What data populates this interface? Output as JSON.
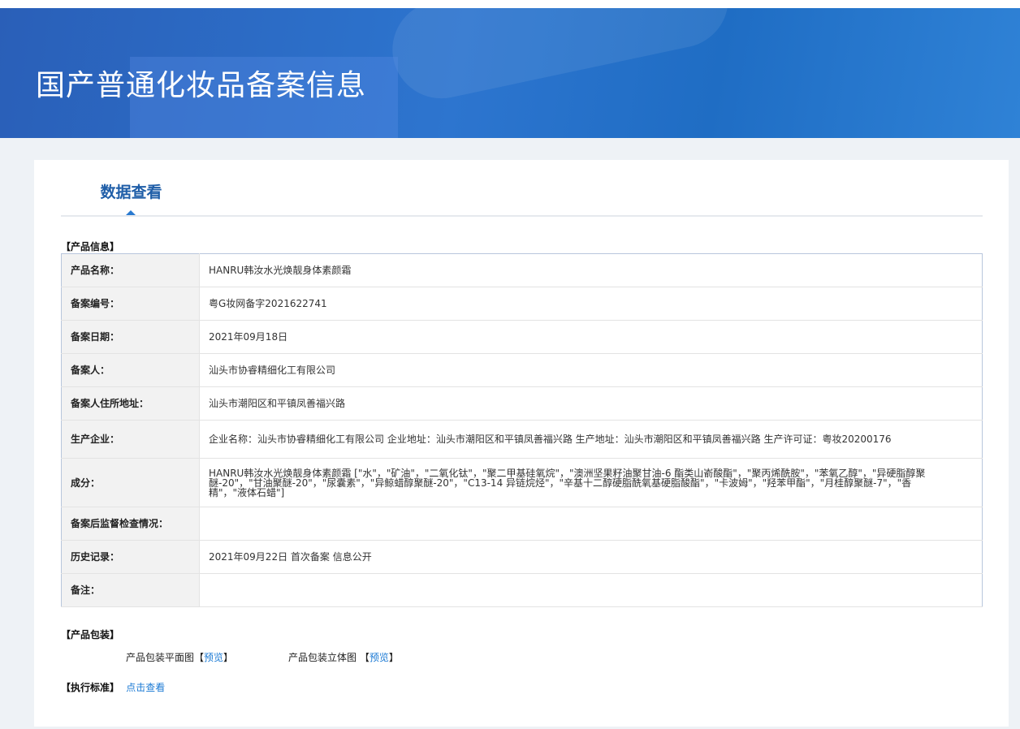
{
  "header": {
    "title": "国产普通化妆品备案信息"
  },
  "tab": {
    "label": "数据查看"
  },
  "product_info": {
    "heading": "【产品信息】",
    "rows": [
      {
        "label": "产品名称：",
        "value": "HANRU韩汝水光焕靓身体素颜霜"
      },
      {
        "label": "备案编号：",
        "value": "粤G妆网备字2021622741"
      },
      {
        "label": "备案日期：",
        "value": "2021年09月18日"
      },
      {
        "label": "备案人：",
        "value": "汕头市协睿精细化工有限公司"
      },
      {
        "label": "备案人住所地址：",
        "value": "汕头市潮阳区和平镇凤善福兴路"
      },
      {
        "label": "生产企业：",
        "value": "企业名称：汕头市协睿精细化工有限公司 企业地址：汕头市潮阳区和平镇凤善福兴路 生产地址：汕头市潮阳区和平镇凤善福兴路 生产许可证：粤妆20200176"
      },
      {
        "label": "成分：",
        "value": "HANRU韩汝水光焕靓身体素颜霜 [\"水\"，\"矿油\"，\"二氧化钛\"，\"聚二甲基硅氧烷\"，\"澳洲坚果籽油聚甘油-6 酯类山嵛酸酯\"，\"聚丙烯酰胺\"，\"苯氧乙醇\"，\"异硬脂醇聚醚-20\"，\"甘油聚醚-20\"，\"尿囊素\"，\"异鲸蜡醇聚醚-20\"，\"C13-14 异链烷烃\"，\"辛基十二醇硬脂酰氧基硬脂酸酯\"，\"卡波姆\"，\"羟苯甲酯\"，\"月桂醇聚醚-7\"，\"香精\"，\"液体石蜡\"]"
      },
      {
        "label": "备案后监督检查情况：",
        "value": ""
      },
      {
        "label": "历史记录：",
        "value": "2021年09月22日 首次备案 信息公开"
      },
      {
        "label": "备注：",
        "value": ""
      }
    ]
  },
  "packaging": {
    "heading": "【产品包装】",
    "flat_label": "产品包装平面图",
    "solid_label": "产品包装立体图",
    "bracket_open": "【",
    "bracket_close": "】",
    "preview": "预览"
  },
  "standard": {
    "heading": "【执行标准】",
    "link": "点击查看"
  }
}
